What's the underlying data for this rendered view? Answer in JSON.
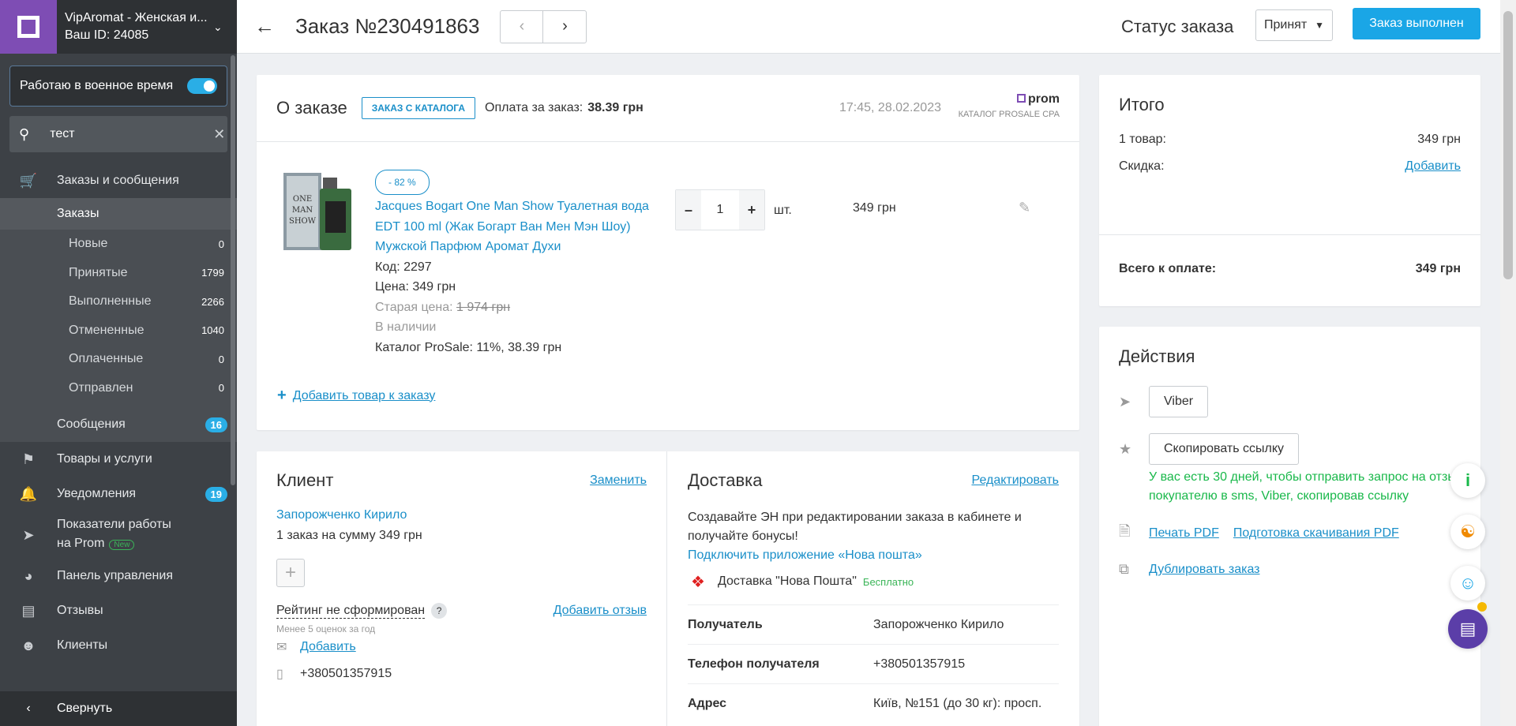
{
  "store": {
    "name": "VipAromat - Женская и...",
    "id": "Ваш ID: 24085"
  },
  "sidebar": {
    "wartime_label": "Работаю в военное время",
    "search_value": "тест",
    "orders_section": "Заказы и сообщения",
    "orders_sub": "Заказы",
    "order_statuses": [
      {
        "label": "Новые",
        "count": "0"
      },
      {
        "label": "Принятые",
        "count": "1799"
      },
      {
        "label": "Выполненные",
        "count": "2266"
      },
      {
        "label": "Отмененные",
        "count": "1040"
      },
      {
        "label": "Оплаченные",
        "count": "0"
      },
      {
        "label": "Отправлен",
        "count": "0"
      }
    ],
    "messages": {
      "label": "Сообщения",
      "count": "16"
    },
    "products": "Товары и услуги",
    "notifications": {
      "label": "Уведомления",
      "count": "19"
    },
    "performance_1": "Показатели работы",
    "performance_2": "на Prom",
    "performance_badge": "New",
    "dashboard": "Панель управления",
    "reviews": "Отзывы",
    "clients": "Клиенты",
    "collapse": "Свернуть"
  },
  "header": {
    "order_title": "Заказ №230491863",
    "status_label": "Статус заказа",
    "status_value": "Принят",
    "done_button": "Заказ выполнен"
  },
  "order": {
    "title": "О заказе",
    "catalog_tag": "ЗАКАЗ С КАТАЛОГА",
    "payment_label": "Оплата за заказ:",
    "payment_value": "38.39 грн",
    "datetime": "17:45, 28.02.2023",
    "prom_logo": "prom",
    "prom_catalog": "КАТАЛОГ PROSALE CPA",
    "product": {
      "discount": "- 82 %",
      "name": "Jacques Bogart One Man Show Туалетная вода EDT 100 ml (Жак Богарт Ван Мен Мэн Шоу) Мужской Парфюм Аромат Духи",
      "code": "Код: 2297",
      "price": "Цена: 349 грн",
      "old_price_label": "Старая цена:",
      "old_price_value": "1 974 грн",
      "availability": "В наличии",
      "catalog": "Каталог ProSale: 11%, 38.39 грн",
      "quantity": "1",
      "unit": "шт.",
      "line_total": "349 грн"
    },
    "add_product": "Добавить товар к заказу"
  },
  "client": {
    "title": "Клиент",
    "change": "Заменить",
    "name": "Запорожченко Кирило",
    "orders": "1 заказ на сумму 349 грн",
    "rating": "Рейтинг не сформирован",
    "add_review": "Добавить отзыв",
    "rating_sub": "Менее 5 оценок за год",
    "add_email": "Добавить",
    "phone": "+380501357915"
  },
  "delivery": {
    "title": "Доставка",
    "edit": "Редактировать",
    "note": "Создавайте ЭН при редактировании заказа в кабинете и получайте бонусы!",
    "connect_app": "Подключить приложение «Нова пошта»",
    "method": "Доставка \"Нова Пошта\"",
    "free": "Бесплатно",
    "rows": [
      {
        "k": "Получатель",
        "v": "Запорожченко Кирило"
      },
      {
        "k": "Телефон получателя",
        "v": "+380501357915"
      },
      {
        "k": "Адрес",
        "v": "Київ, №151 (до 30 кг): просп."
      }
    ]
  },
  "totals": {
    "title": "Итого",
    "items_label": "1 товар:",
    "items_value": "349 грн",
    "discount_label": "Скидка:",
    "discount_add": "Добавить",
    "total_label": "Всего к оплате:",
    "total_value": "349 грн"
  },
  "actions": {
    "title": "Действия",
    "viber": "Viber",
    "copy_link": "Скопировать ссылку",
    "note": "У вас есть 30 дней, чтобы отправить запрос на отзыв покупателю в sms, Viber, скопировав ссылку",
    "print_pdf": "Печать PDF",
    "prepare_pdf": "Подготовка скачивания PDF",
    "duplicate": "Дублировать заказ"
  }
}
